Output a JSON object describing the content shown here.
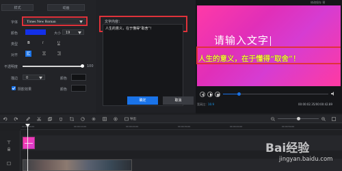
{
  "tabs": {
    "style": "样式",
    "animation": "动画"
  },
  "font": {
    "label": "字体",
    "value": "Times New Roman"
  },
  "color": {
    "label": "颜色",
    "swatch": "#1330e8"
  },
  "size": {
    "label": "大小",
    "value": "19"
  },
  "type": {
    "label": "类型",
    "bold": "B",
    "italic": "I",
    "underline": "U"
  },
  "align": {
    "label": "对齐"
  },
  "opacity": {
    "label": "不透明度",
    "value": "100"
  },
  "stroke": {
    "label": "描边",
    "value": "0",
    "color_label": "颜色"
  },
  "shadow": {
    "label": "阴影效果",
    "color_label": "颜色"
  },
  "text_content": {
    "label": "文字内容：",
    "value": "人生的意义，在于懂得“取舍”！"
  },
  "buttons": {
    "ok": "确定",
    "cancel": "取消"
  },
  "preview": {
    "top_text": "修改保存 预",
    "main_text": "请输入文字",
    "caption_text": "人生的意义，在于懂得“取舍”！",
    "time_current": "00:00:02.35",
    "time_total": "00:00:42.89",
    "ratio_label": "宽高比：",
    "ratio_value": "16:9",
    "progress": 0.15
  },
  "toolbar": {
    "export": "导出"
  },
  "ruler": [
    "00:00:00.00",
    "00:00:10.00",
    "00:00:20.00",
    "00:00:30.00",
    "00:00:40.00",
    "00:00:50.00"
  ],
  "watermark": {
    "site": "Bai经验",
    "url": "jingyan.baidu.com"
  },
  "colors": {
    "accent": "#1a73e8",
    "highlight": "#e0323a",
    "caption": "#f7ec3d"
  }
}
